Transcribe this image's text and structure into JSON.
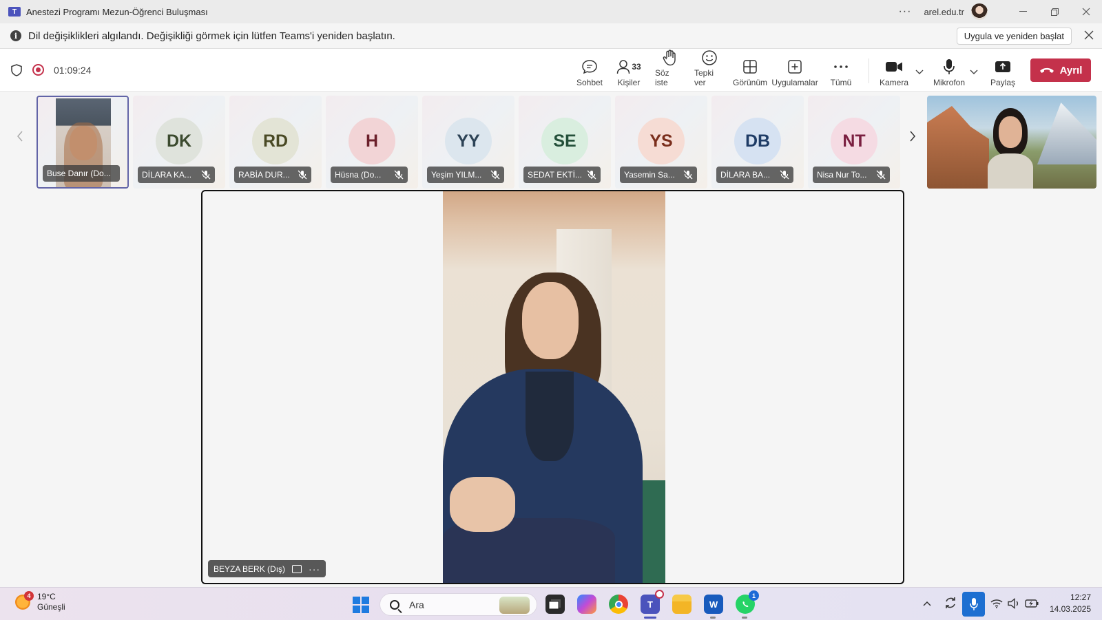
{
  "window": {
    "title": "Anestezi Programı Mezun-Öğrenci Buluşması",
    "org": "arel.edu.tr",
    "more": "···"
  },
  "notice": {
    "message": "Dil değişiklikleri algılandı. Değişikliği görmek için lütfen Teams'i yeniden başlatın.",
    "action": "Uygula ve yeniden başlat"
  },
  "meeting": {
    "timer": "01:09:24",
    "toolbar": {
      "chat": "Sohbet",
      "people": "Kişiler",
      "people_count": "33",
      "raise_hand": "Söz iste",
      "react": "Tepki ver",
      "view": "Görünüm",
      "apps": "Uygulamalar",
      "more": "Tümü",
      "camera": "Kamera",
      "mic": "Mikrofon",
      "share": "Paylaş",
      "leave": "Ayrıl"
    },
    "colors": {
      "leave": "#c4314b",
      "accent": "#6264a7"
    }
  },
  "participants": [
    {
      "initials": "",
      "name": "Buse Danır (Do...",
      "video": true,
      "active": true
    },
    {
      "initials": "DK",
      "name": "DİLARA KA...",
      "bg": "#dfe3dc",
      "fg": "#3b4a2e"
    },
    {
      "initials": "RD",
      "name": "RABİA DUR...",
      "bg": "#e3e4d6",
      "fg": "#4a4a25"
    },
    {
      "initials": "H",
      "name": "Hüsna (Do...",
      "bg": "#f2d4d6",
      "fg": "#6b1f2a"
    },
    {
      "initials": "YY",
      "name": "Yeşim YILM...",
      "bg": "#dce6ee",
      "fg": "#2d4356"
    },
    {
      "initials": "SE",
      "name": "SEDAT EKTİ...",
      "bg": "#d9eedf",
      "fg": "#24503a"
    },
    {
      "initials": "YS",
      "name": "Yasemin Sa...",
      "bg": "#f6dcd4",
      "fg": "#7a2e1c"
    },
    {
      "initials": "DB",
      "name": "DİLARA BA...",
      "bg": "#d6e2f2",
      "fg": "#1f3c66"
    },
    {
      "initials": "NT",
      "name": "Nisa Nur To...",
      "bg": "#f5dbe3",
      "fg": "#7a1f40"
    }
  ],
  "stage": {
    "speaker_name": "BEYZA BERK (Dış)",
    "more": "···"
  },
  "taskbar": {
    "weather_badge": "4",
    "temperature": "19°C",
    "condition": "Güneşli",
    "search_placeholder": "Ara",
    "teams_badge": "",
    "whatsapp_badge": "1",
    "time": "12:27",
    "date": "14.03.2025"
  }
}
